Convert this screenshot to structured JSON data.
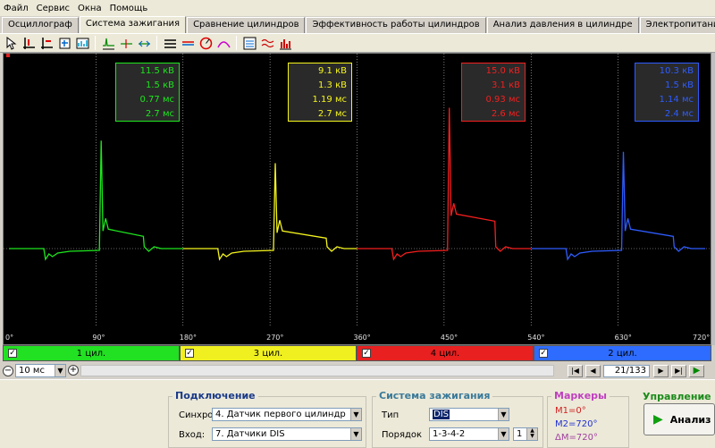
{
  "menu": [
    "Файл",
    "Сервис",
    "Окна",
    "Помощь"
  ],
  "tabs": [
    {
      "label": "Осциллограф",
      "active": false
    },
    {
      "label": "Система зажигания",
      "active": true
    },
    {
      "label": "Сравнение цилиндров",
      "active": false
    },
    {
      "label": "Эффективность работы цилиндров",
      "active": false
    },
    {
      "label": "Анализ давления в цилиндре",
      "active": false
    },
    {
      "label": "Электропитание",
      "active": false
    }
  ],
  "toolbar_icons": [
    "select-arrow-icon",
    "cursor-marker-icon",
    "level-marker-icon",
    "zoom-fit-icon",
    "bar-settings-icon",
    "oscillogram-icon",
    "cursors-icon",
    "shift-icon",
    "lines-icon",
    "superimpose-icon",
    "polar-icon",
    "parade-icon",
    "raster-icon",
    "waveform-icon",
    "histogram-icon"
  ],
  "scope": {
    "background": "#000000",
    "x_ticks": [
      "0°",
      "90°",
      "180°",
      "270°",
      "360°",
      "450°",
      "540°",
      "630°",
      "720°"
    ],
    "cylinders": [
      {
        "color": "#1ee61e",
        "values": [
          "11.5 кВ",
          "1.5 кВ",
          "0.77 мс",
          "2.7 мс"
        ]
      },
      {
        "color": "#f5f51e",
        "values": [
          "9.1 кВ",
          "1.3 кВ",
          "1.19 мс",
          "2.7 мс"
        ]
      },
      {
        "color": "#f51e1e",
        "values": [
          "15.0 кВ",
          "3.1 кВ",
          "0.93 мс",
          "2.6 мс"
        ]
      },
      {
        "color": "#2e5cff",
        "values": [
          "10.3 кВ",
          "1.5 кВ",
          "1.14 мс",
          "2.4 мс"
        ]
      }
    ]
  },
  "cylinder_bar": [
    {
      "label": "1 цил.",
      "color": "#22e022",
      "checked": true
    },
    {
      "label": "3 цил.",
      "color": "#f0f020",
      "checked": true
    },
    {
      "label": "4 цил.",
      "color": "#e82020",
      "checked": true
    },
    {
      "label": "2 цил.",
      "color": "#2e6cff",
      "checked": true
    }
  ],
  "nav": {
    "timebase": "10 мс",
    "page": "21/133",
    "minus": "−",
    "plus": "+"
  },
  "connection": {
    "title": "Подключение",
    "sync_label": "Синхро:",
    "sync_value": "4. Датчик первого цилиндр",
    "input_label": "Вход:",
    "input_value": "7. Датчики DIS"
  },
  "ignition": {
    "title": "Система зажигания",
    "type_label": "Тип",
    "type_value": "DIS",
    "order_label": "Порядок",
    "order_value": "1-3-4-2",
    "cyl_value": "1"
  },
  "markers": {
    "title": "Маркеры",
    "m1": "M1=0°",
    "m2": "M2=720°",
    "dm": "ΔM=720°"
  },
  "control": {
    "title": "Управление",
    "analyze_label": "Анализ"
  }
}
